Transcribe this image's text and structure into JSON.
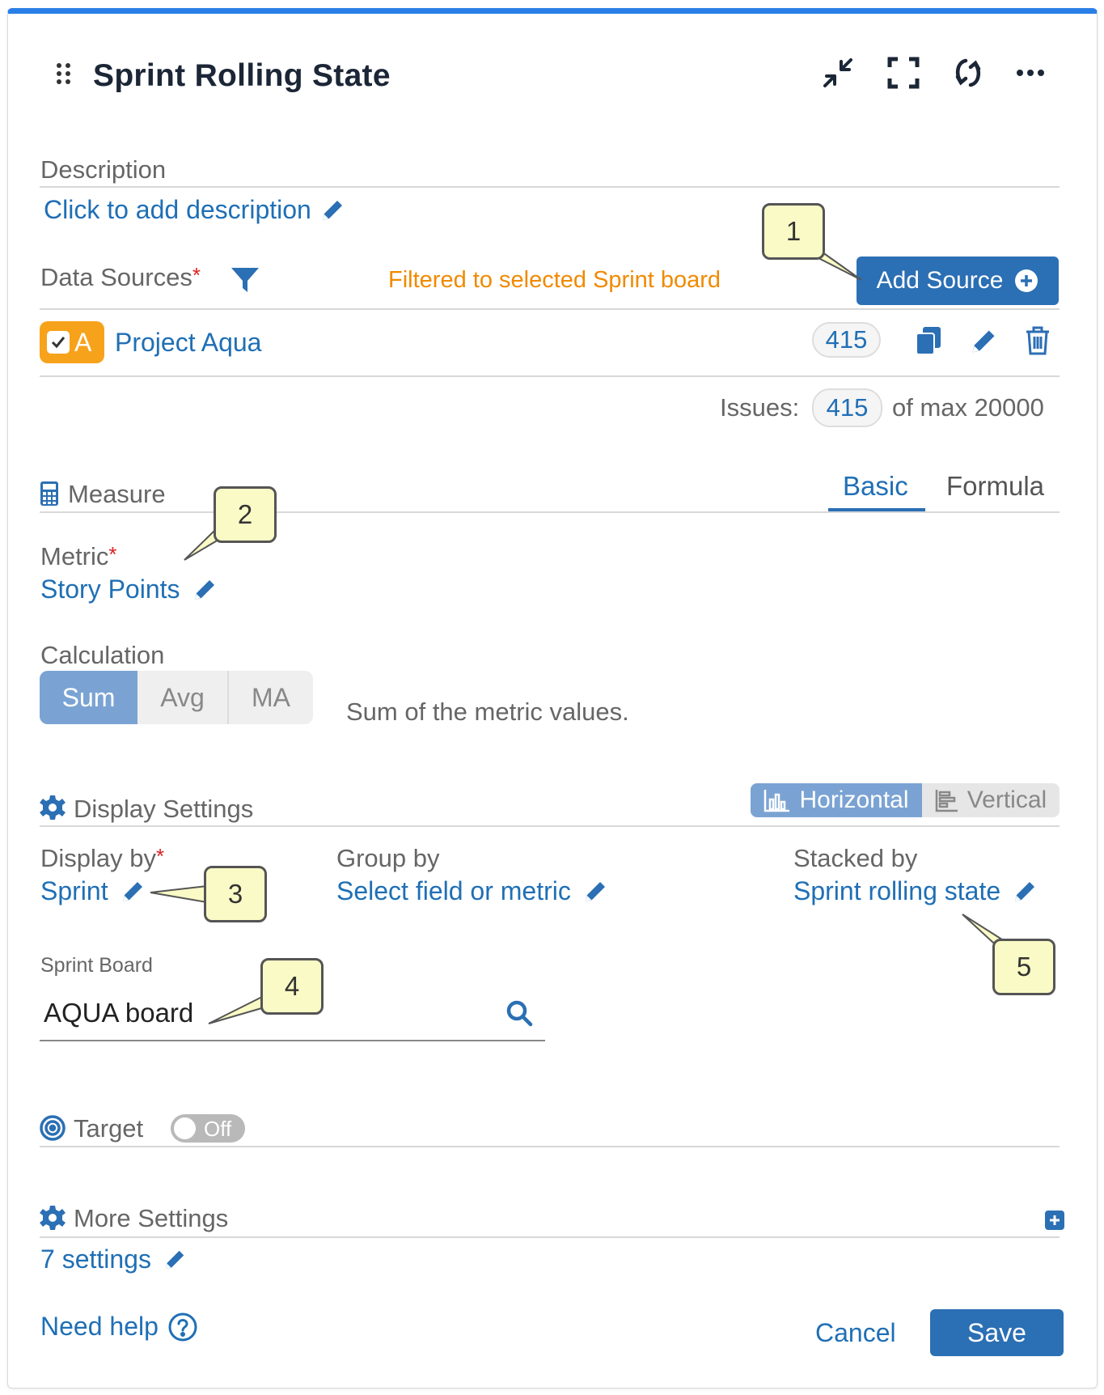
{
  "header": {
    "title": "Sprint Rolling State",
    "icons": [
      "drag-handle-icon",
      "minimize-icon",
      "fullscreen-icon",
      "refresh-icon",
      "more-icon"
    ]
  },
  "description": {
    "label": "Description",
    "link": "Click to add description"
  },
  "data_sources": {
    "label": "Data Sources",
    "required_mark": "*",
    "filter_note": "Filtered to selected Sprint board",
    "add_button": "Add Source",
    "source": {
      "badge": "A",
      "name": "Project Aqua",
      "count": "415"
    },
    "issues_label": "Issues:",
    "issues_count": "415",
    "issues_max": "of max 20000",
    "colors": {
      "badge": "#f7a21b",
      "accent": "#2b6fb4",
      "note": "#f08a00"
    }
  },
  "measure": {
    "label": "Measure",
    "tabs": [
      "Basic",
      "Formula"
    ],
    "active_tab": "Basic",
    "metric_label": "Metric",
    "metric_value": "Story Points",
    "calculation_label": "Calculation",
    "calc_options": [
      "Sum",
      "Avg",
      "MA"
    ],
    "calc_selected": "Sum",
    "calc_description": "Sum of the metric values."
  },
  "display": {
    "label": "Display Settings",
    "orientation_options": [
      "Horizontal",
      "Vertical"
    ],
    "orientation_selected": "Horizontal",
    "display_by_label": "Display by",
    "display_by_value": "Sprint",
    "group_by_label": "Group by",
    "group_by_value": "Select field or metric",
    "stacked_by_label": "Stacked by",
    "stacked_by_value": "Sprint rolling state",
    "sprint_board_label": "Sprint Board",
    "sprint_board_value": "AQUA board"
  },
  "target": {
    "label": "Target",
    "toggle": "Off"
  },
  "more_settings": {
    "label": "More Settings",
    "link": "7 settings"
  },
  "footer": {
    "help": "Need help",
    "cancel": "Cancel",
    "save": "Save"
  },
  "callouts": [
    "1",
    "2",
    "3",
    "4",
    "5"
  ]
}
